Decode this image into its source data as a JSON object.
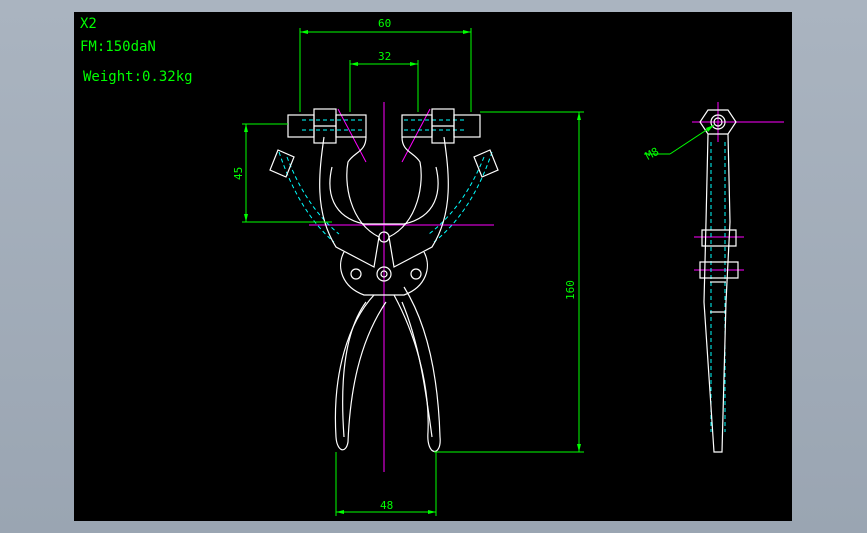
{
  "notes": {
    "qty": "X2",
    "force": "FM:150daN",
    "weight": "Weight:0.32kg"
  },
  "dimensions": {
    "outer_width": "60",
    "inner_width": "32",
    "jaw_height": "45",
    "overall_length": "160",
    "handle_span": "48",
    "thread": "M8"
  },
  "colors": {
    "background": "#000000",
    "outline": "#ffffff",
    "dimension": "#00ff00",
    "centerline": "#ff00ff",
    "hidden": "#00ffff"
  }
}
